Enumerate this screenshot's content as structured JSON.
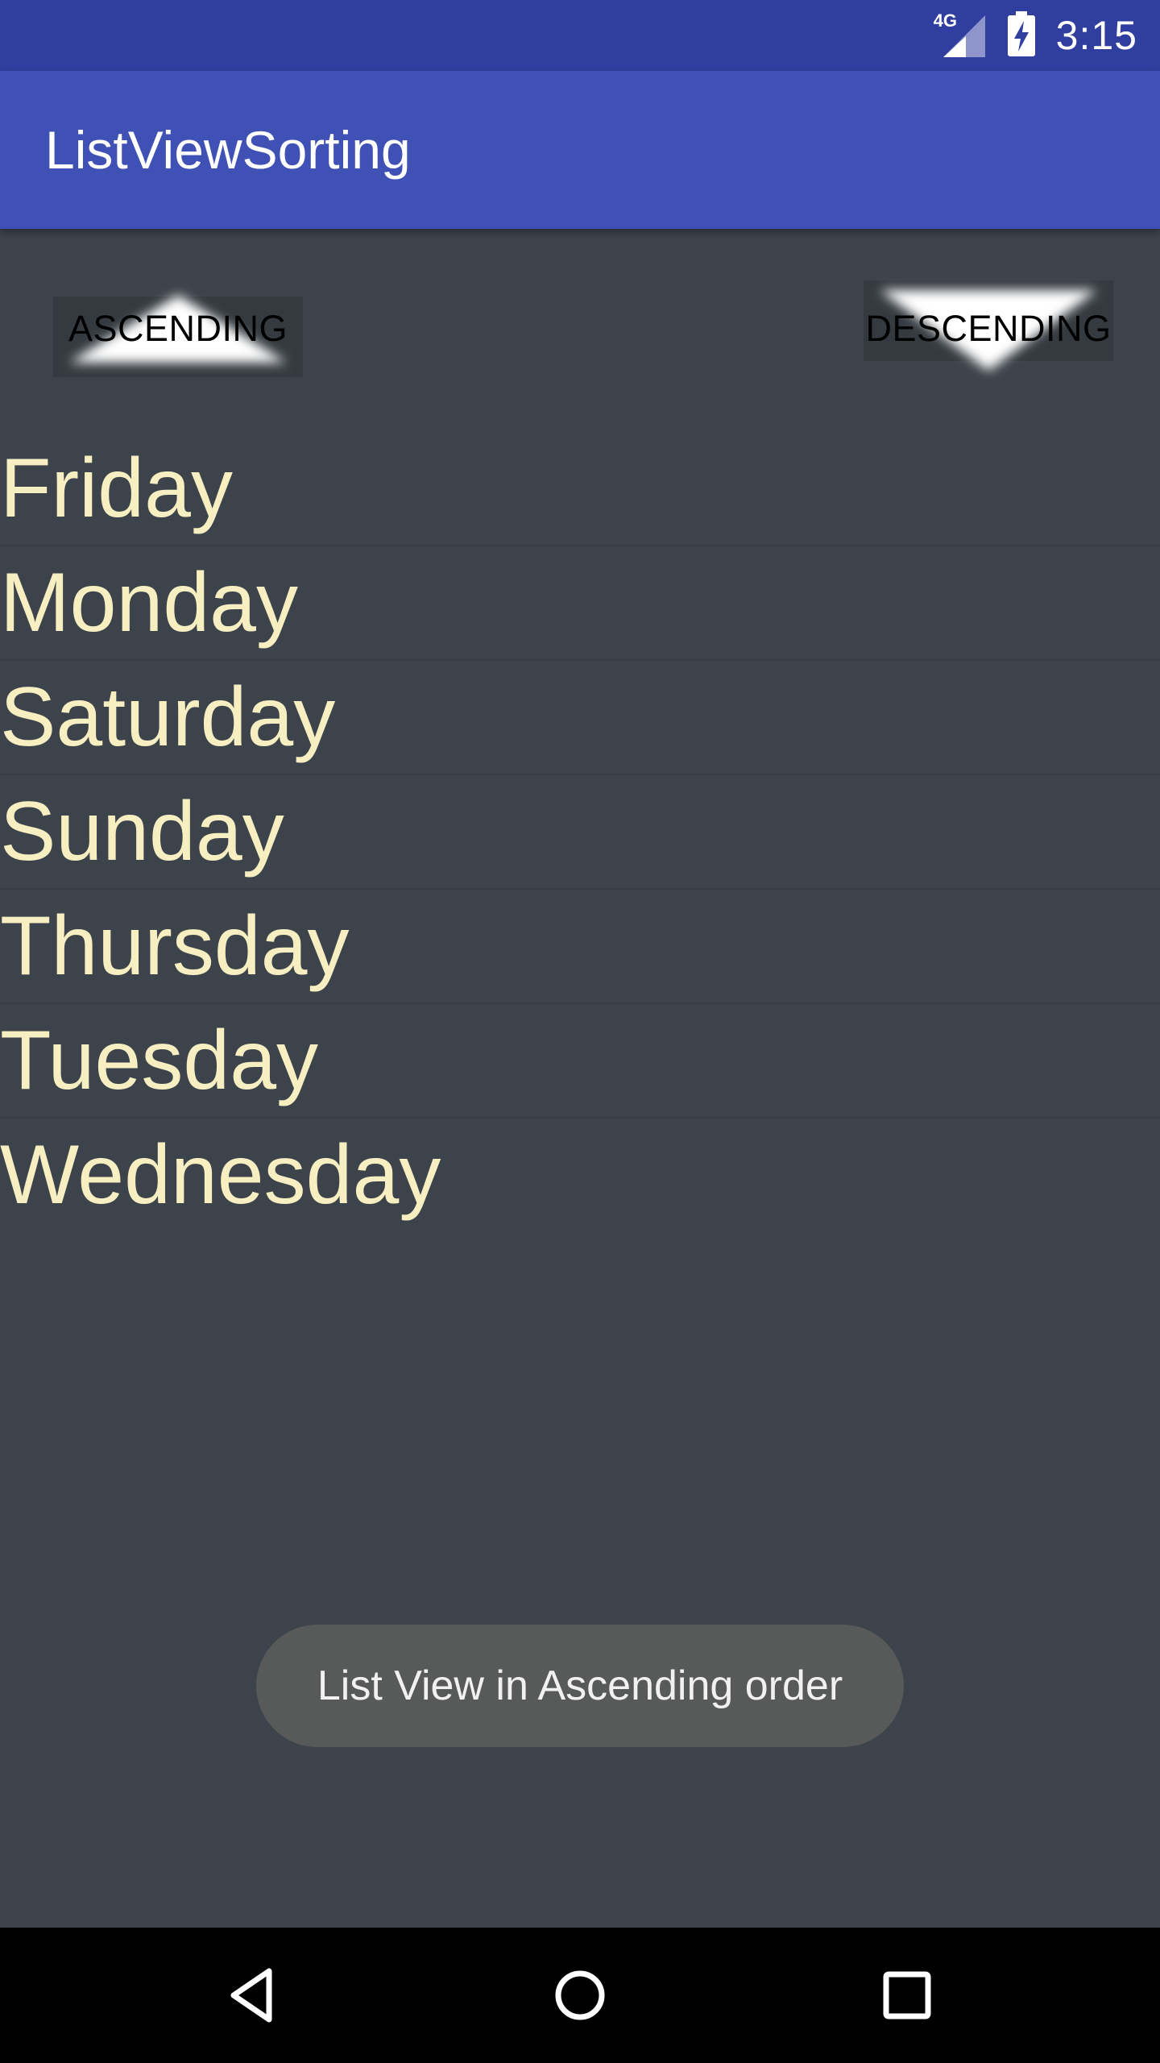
{
  "status_bar": {
    "network_label": "4G",
    "time": "3:15",
    "icons": [
      "signal-icon",
      "battery-charging-icon"
    ]
  },
  "app_bar": {
    "title": "ListViewSorting"
  },
  "sort_buttons": {
    "ascending_label": "ASCENDING",
    "descending_label": "DESCENDING"
  },
  "days": [
    "Friday",
    "Monday",
    "Saturday",
    "Sunday",
    "Thursday",
    "Tuesday",
    "Wednesday"
  ],
  "toast": {
    "message": "List View in Ascending order"
  },
  "nav_bar": {
    "icons": [
      "back-icon",
      "home-icon",
      "recents-icon"
    ]
  },
  "colors": {
    "status_bar": "#303f9f",
    "app_bar": "#3f51b5",
    "background": "#3c434a",
    "list_text": "#f7eec2",
    "toast_bg": "#575a58"
  }
}
